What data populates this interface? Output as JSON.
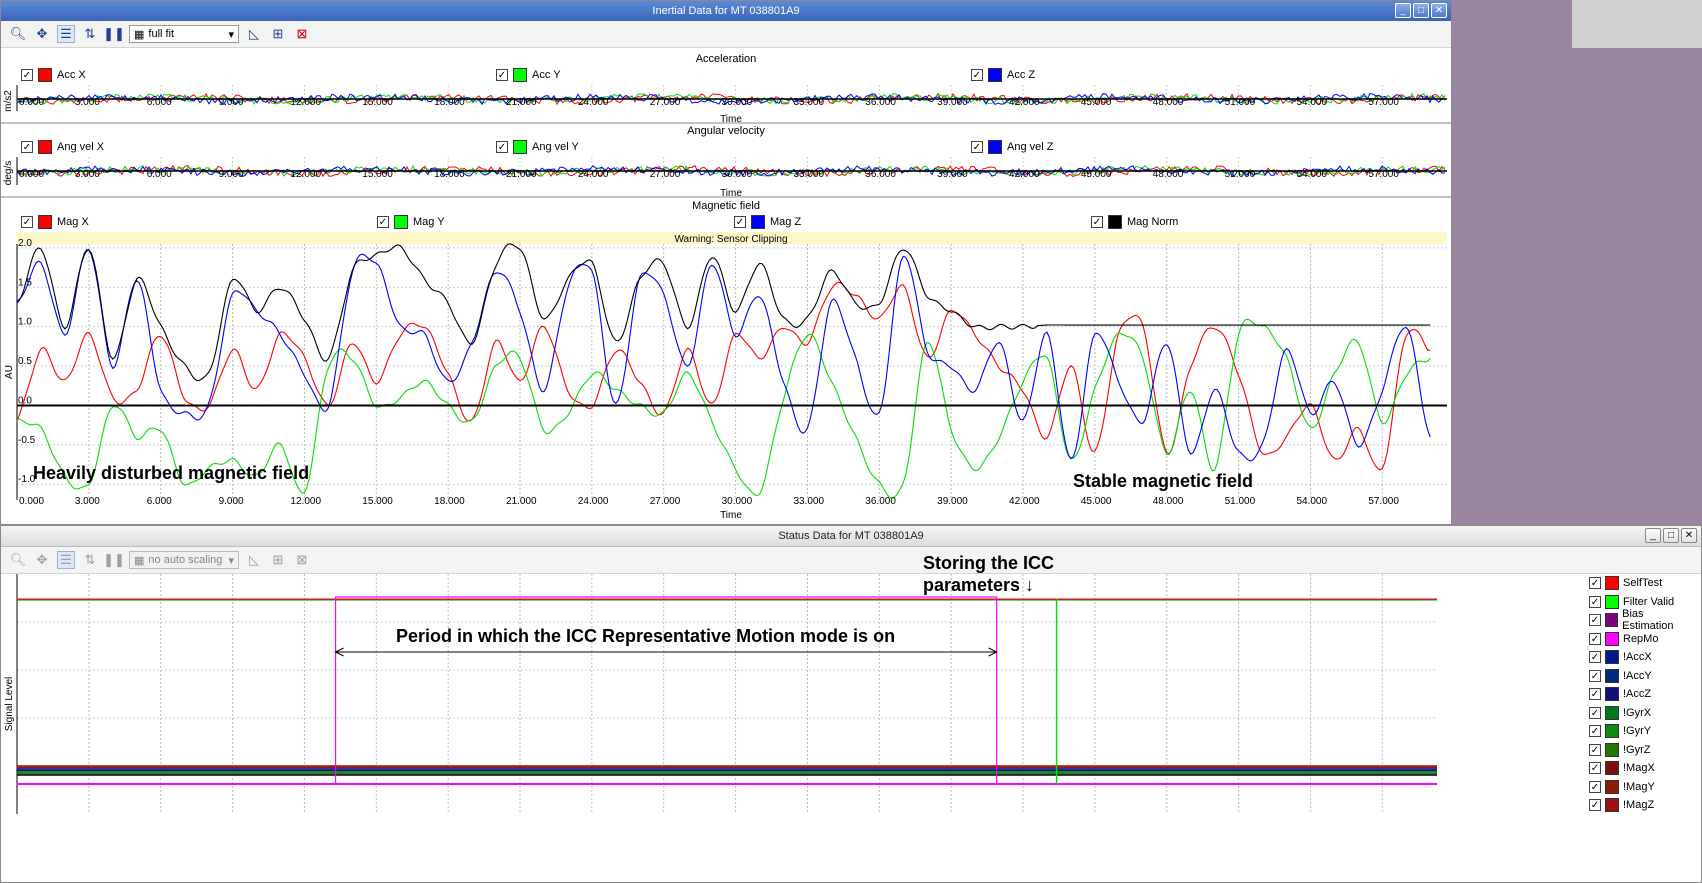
{
  "colors": {
    "red": "#ff0000",
    "green": "#00e000",
    "blue": "#0000ff",
    "black": "#000000",
    "magenta": "#ff00ff"
  },
  "top_window": {
    "title": "Inertial Data for MT 038801A9",
    "window_buttons": [
      "_",
      "□",
      "✕"
    ],
    "toolbar": {
      "scale_select": "full fit"
    },
    "x_ticks": [
      "0.000",
      "3.000",
      "6.000",
      "9.000",
      "12.000",
      "15.000",
      "18.000",
      "21.000",
      "24.000",
      "27.000",
      "30.000",
      "33.000",
      "36.000",
      "39.000",
      "42.000",
      "45.000",
      "48.000",
      "51.000",
      "54.000",
      "57.000"
    ],
    "x_label": "Time",
    "acceleration": {
      "title": "Acceleration",
      "ylabel": "m/s2",
      "legend": [
        "Acc X",
        "Acc Y",
        "Acc Z"
      ]
    },
    "angular_velocity": {
      "title": "Angular velocity",
      "ylabel": "deg/s",
      "legend": [
        "Ang vel X",
        "Ang vel Y",
        "Ang vel Z"
      ]
    },
    "magnetic_field": {
      "title": "Magnetic field",
      "ylabel": "AU",
      "warning": "Warning: Sensor Clipping",
      "legend": [
        "Mag X",
        "Mag Y",
        "Mag Z",
        "Mag Norm"
      ],
      "y_ticks": [
        "2.0",
        "1.5",
        "1.0",
        "0.5",
        "0.0",
        "-0.5",
        "-1.0"
      ],
      "annotation_left": "Heavily disturbed magnetic field",
      "annotation_right": "Stable magnetic field"
    }
  },
  "bottom_window": {
    "title": "Status Data for MT 038801A9",
    "window_buttons": [
      "_",
      "□",
      "✕"
    ],
    "toolbar": {
      "scale_select": "no auto scaling"
    },
    "ylabel": "Signal Level",
    "annotation_store_line1": "Storing the ICC",
    "annotation_store_line2": "parameters ↓",
    "annotation_period": "Period in which the ICC Representative Motion mode is on",
    "legend": [
      {
        "label": "SelfTest",
        "color": "#ff0000"
      },
      {
        "label": "Filter Valid",
        "color": "#00ff00"
      },
      {
        "label": "Bias Estimation",
        "color": "#800080"
      },
      {
        "label": "RepMo",
        "color": "#ff00ff"
      },
      {
        "label": "!AccX",
        "color": "#001a8c"
      },
      {
        "label": "!AccY",
        "color": "#002a80"
      },
      {
        "label": "!AccZ",
        "color": "#10107a"
      },
      {
        "label": "!GyrX",
        "color": "#007a20"
      },
      {
        "label": "!GyrY",
        "color": "#108a10"
      },
      {
        "label": "!GyrZ",
        "color": "#207a00"
      },
      {
        "label": "!MagX",
        "color": "#7a1010"
      },
      {
        "label": "!MagY",
        "color": "#8a2000"
      },
      {
        "label": "!MagZ",
        "color": "#a01010"
      }
    ]
  },
  "chart_data": [
    {
      "type": "line",
      "title": "Magnetic field",
      "xlabel": "Time",
      "ylabel": "AU",
      "xlim": [
        0,
        59.7
      ],
      "ylim": [
        -1.2,
        2.1
      ],
      "x": [
        0,
        1,
        2,
        3,
        4,
        5,
        6,
        7,
        8,
        9,
        10,
        11,
        12,
        13,
        14,
        15,
        16,
        17,
        18,
        19,
        20,
        21,
        22,
        23,
        24,
        25,
        26,
        27,
        28,
        29,
        30,
        31,
        32,
        33,
        34,
        35,
        36,
        37,
        38,
        39,
        40,
        41,
        42,
        43,
        44,
        45,
        46,
        47,
        48,
        49,
        50,
        51,
        52,
        53,
        54,
        55,
        56,
        57,
        58,
        59
      ],
      "series": [
        {
          "name": "Mag X",
          "values": [
            -0.2,
            0.7,
            0.3,
            0.9,
            0.1,
            0.2,
            0.9,
            0.1,
            0.0,
            0.7,
            0.2,
            0.9,
            0.6,
            0.0,
            0.8,
            0.3,
            0.9,
            1.0,
            0.4,
            -0.2,
            0.8,
            0.3,
            1.0,
            0.2,
            0.0,
            0.7,
            0.3,
            -0.1,
            0.7,
            0.0,
            0.9,
            0.6,
            1.0,
            0.8,
            1.5,
            1.4,
            1.1,
            1.5,
            0.6,
            1.2,
            0.9,
            0.5,
            0.2,
            -0.4,
            0.5,
            -0.6,
            0.9,
            1.0,
            -0.6,
            0.5,
            1.0,
            0.4,
            -0.6,
            -0.4,
            0.0,
            -0.7,
            -0.3,
            -0.8,
            0.9,
            0.7
          ]
        },
        {
          "name": "Mag Y",
          "values": [
            -0.2,
            -0.3,
            -0.9,
            -1.0,
            0.0,
            -0.4,
            -0.3,
            -1.0,
            -0.8,
            -0.7,
            -0.9,
            -0.5,
            -1.1,
            0.5,
            0.6,
            0.0,
            0.1,
            0.3,
            0.0,
            -0.2,
            0.5,
            0.6,
            -0.3,
            -0.1,
            0.4,
            0.2,
            0.0,
            -0.1,
            0.4,
            -0.2,
            -0.8,
            -1.1,
            0.1,
            0.9,
            0.3,
            -0.4,
            -1.0,
            -1.0,
            0.8,
            -0.3,
            -0.8,
            -0.4,
            0.3,
            0.6,
            -0.7,
            0.2,
            0.9,
            0.6,
            -0.6,
            0.2,
            -0.8,
            0.9,
            1.0,
            0.6,
            -0.3,
            0.4,
            0.8,
            -0.2,
            0.4,
            0.6
          ]
        },
        {
          "name": "Mag Z",
          "values": [
            1.3,
            1.8,
            0.9,
            2.0,
            0.5,
            1.6,
            0.2,
            -0.1,
            0.0,
            1.4,
            1.2,
            0.9,
            0.4,
            0.0,
            1.7,
            1.8,
            1.0,
            0.9,
            0.3,
            0.8,
            1.7,
            1.2,
            0.2,
            1.5,
            1.7,
            0.0,
            1.6,
            1.4,
            0.5,
            1.8,
            0.9,
            1.4,
            0.3,
            -0.3,
            1.3,
            0.6,
            -0.1,
            1.9,
            0.7,
            0.5,
            0.2,
            0.8,
            -0.2,
            0.9,
            -0.7,
            0.9,
            0.3,
            -0.2,
            0.8,
            -0.6,
            0.2,
            -0.6,
            -0.5,
            0.7,
            -0.1,
            0.3,
            -0.5,
            0.2,
            1.0,
            -0.4
          ]
        },
        {
          "name": "Mag Norm",
          "values": [
            1.3,
            2.0,
            1.0,
            2.0,
            0.6,
            1.6,
            1.0,
            0.5,
            0.4,
            1.6,
            1.2,
            1.5,
            1.1,
            0.6,
            1.7,
            1.9,
            2.0,
            1.6,
            1.3,
            0.8,
            1.8,
            2.0,
            1.1,
            1.6,
            1.8,
            0.8,
            1.6,
            1.8,
            1.0,
            1.9,
            1.2,
            1.8,
            1.1,
            1.1,
            1.7,
            1.3,
            1.3,
            2.0,
            1.4,
            1.2,
            1.0,
            1.0,
            1.0,
            1.02,
            1.02,
            1.02,
            1.02,
            1.02,
            1.02,
            1.02,
            1.02,
            1.02,
            1.02,
            1.02,
            1.02,
            1.02,
            1.02,
            1.02,
            1.02,
            1.02
          ]
        }
      ]
    }
  ]
}
